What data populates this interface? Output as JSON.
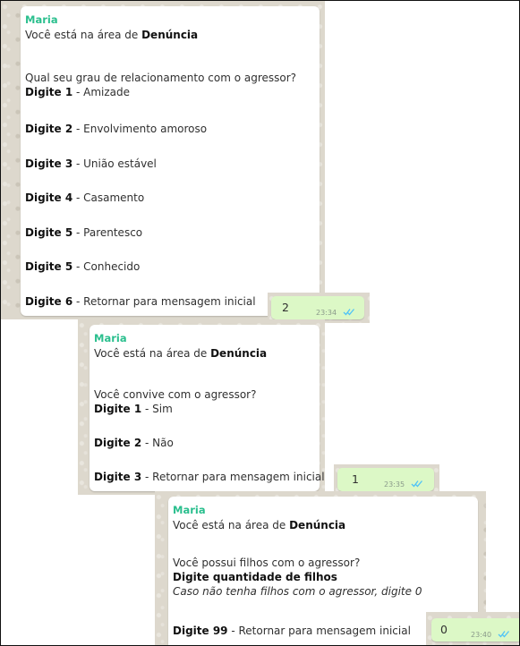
{
  "chat": {
    "colors": {
      "sender_name": "#2bbf8e",
      "outgoing_bubble": "#dcf8c6",
      "ticks": "#4fc3f7"
    },
    "messages": [
      {
        "sender": "Maria",
        "area_prefix": "Você está na área de ",
        "area": "Denúncia",
        "question": "Qual seu grau de relacionamento com o agressor?",
        "options": [
          {
            "prefix": "Digite 1",
            "text": " - Amizade"
          },
          {
            "prefix": "Digite 2",
            "text": " - Envolvimento amoroso"
          },
          {
            "prefix": "Digite 3",
            "text": " - União estável"
          },
          {
            "prefix": "Digite 4",
            "text": " - Casamento"
          },
          {
            "prefix": "Digite 5",
            "text": " - Parentesco"
          },
          {
            "prefix": "Digite 5",
            "text": " - Conhecido"
          },
          {
            "prefix": "Digite 6",
            "text": " - Retornar para mensagem inicial"
          }
        ],
        "reply": {
          "text": "2",
          "time": "23:34",
          "status_icon": "double-check-icon"
        }
      },
      {
        "sender": "Maria",
        "area_prefix": "Você está na área de ",
        "area": "Denúncia",
        "question": "Você convive com o agressor?",
        "options": [
          {
            "prefix": "Digite 1",
            "text": " - Sim"
          },
          {
            "prefix": "Digite 2",
            "text": " - Não"
          },
          {
            "prefix": "Digite 3",
            "text": " - Retornar para mensagem inicial"
          }
        ],
        "reply": {
          "text": "1",
          "time": "23:35",
          "status_icon": "double-check-icon"
        }
      },
      {
        "sender": "Maria",
        "area_prefix": "Você está na área de ",
        "area": "Denúncia",
        "question": "Você possui filhos com o agressor?",
        "instruction": "Digite quantidade de filhos",
        "note": "Caso não tenha filhos com o agressor, digite 0",
        "options": [
          {
            "prefix": "Digite 99",
            "text": " - Retornar para mensagem inicial"
          }
        ],
        "reply": {
          "text": "0",
          "time": "23:40",
          "status_icon": "double-check-icon"
        }
      }
    ]
  }
}
